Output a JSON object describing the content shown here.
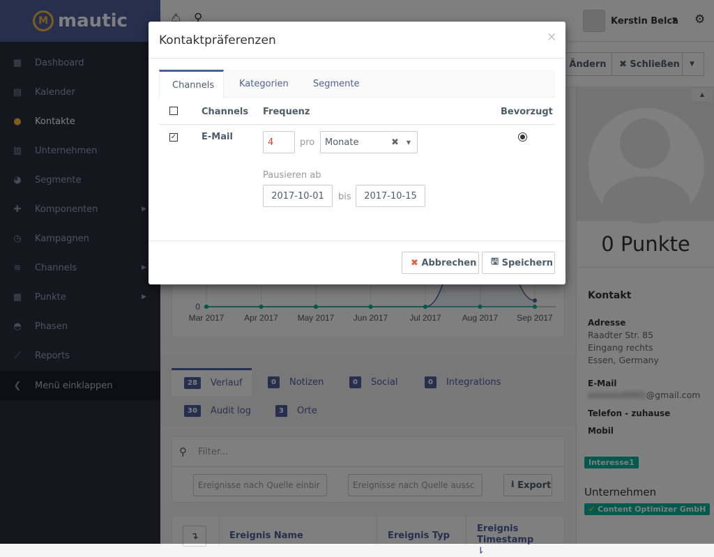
{
  "app": {
    "logo_text": "mautic"
  },
  "sidebar": {
    "items": [
      {
        "label": "Dashboard",
        "icon": "dashboard-icon",
        "glyph": "▦"
      },
      {
        "label": "Kalender",
        "icon": "calendar-icon",
        "glyph": "▤"
      },
      {
        "label": "Kontakte",
        "icon": "user-icon",
        "glyph": "●",
        "active": true
      },
      {
        "label": "Unternehmen",
        "icon": "building-icon",
        "glyph": "▥"
      },
      {
        "label": "Segmente",
        "icon": "pie-chart-icon",
        "glyph": "◕"
      },
      {
        "label": "Komponenten",
        "icon": "puzzle-icon",
        "glyph": "✚",
        "submenu": true
      },
      {
        "label": "Kampagnen",
        "icon": "clock-icon",
        "glyph": "◷"
      },
      {
        "label": "Channels",
        "icon": "rss-icon",
        "glyph": "≋",
        "submenu": true
      },
      {
        "label": "Punkte",
        "icon": "calculator-icon",
        "glyph": "▦",
        "submenu": true
      },
      {
        "label": "Phasen",
        "icon": "tachometer-icon",
        "glyph": "◓"
      },
      {
        "label": "Reports",
        "icon": "line-chart-icon",
        "glyph": "⟋"
      }
    ],
    "collapse_label": "Menü einklappen"
  },
  "header": {
    "user_name": "Kerstin Belca"
  },
  "toolbar": {
    "edit_label": "Ändern",
    "close_label": "Schließen"
  },
  "chart_data": {
    "type": "line",
    "categories": [
      "Mar 2017",
      "Apr 2017",
      "May 2017",
      "Jun 2017",
      "Jul 2017",
      "Aug 2017",
      "Sep 2017"
    ],
    "y_ticks": [
      "0"
    ],
    "series": [
      {
        "values": [
          0,
          0,
          0,
          0,
          0,
          6,
          0.3
        ],
        "color": "#4e5e9e"
      },
      {
        "values": [
          0,
          0,
          0,
          0,
          0,
          0,
          0
        ],
        "color": "#00b49c"
      }
    ]
  },
  "tabs": [
    {
      "count": "28",
      "label": "Verlauf",
      "active": true
    },
    {
      "count": "0",
      "label": "Notizen"
    },
    {
      "count": "0",
      "label": "Social"
    },
    {
      "count": "0",
      "label": "Integrations"
    },
    {
      "count": "30",
      "label": "Audit log"
    },
    {
      "count": "3",
      "label": "Orte"
    }
  ],
  "filter": {
    "placeholder": "Filter...",
    "include_placeholder": "Ereignisse nach Quelle einbir",
    "exclude_placeholder": "Ereignisse nach Quelle aussc",
    "export_label": "Export"
  },
  "table": {
    "columns": [
      "Ereignis Name",
      "Ereignis Typ",
      "Ereignis Timestamp"
    ]
  },
  "contact": {
    "points": "0 Punkte",
    "section": "Kontakt",
    "address_label": "Adresse",
    "address": [
      "Raadter Str. 85",
      "Eingang rechts",
      "Essen, Germany"
    ],
    "email_label": "E-Mail",
    "email_blurred": "xxxxxxx0001",
    "email_domain": "@gmail.com",
    "phone_label": "Telefon - zuhause",
    "mobile_label": "Mobil",
    "tag": "Interesse1",
    "company_section": "Unternehmen",
    "company": "Content Optimizer GmbH"
  },
  "modal": {
    "title": "Kontaktpräferenzen",
    "tabs": [
      "Channels",
      "Kategorien",
      "Segmente"
    ],
    "columns": {
      "channel": "Channels",
      "frequency": "Frequenz",
      "preferred": "Bevorzugt"
    },
    "row": {
      "channel": "E-Mail",
      "checked": true,
      "frequency_number": "4",
      "per_label": "pro",
      "frequency_unit": "Monate",
      "pause_label": "Pausieren ab",
      "pause_from": "2017-10-01",
      "until_label": "bis",
      "pause_to": "2017-10-15",
      "preferred": true
    },
    "cancel_label": "Abbrechen",
    "save_label": "Speichern"
  }
}
